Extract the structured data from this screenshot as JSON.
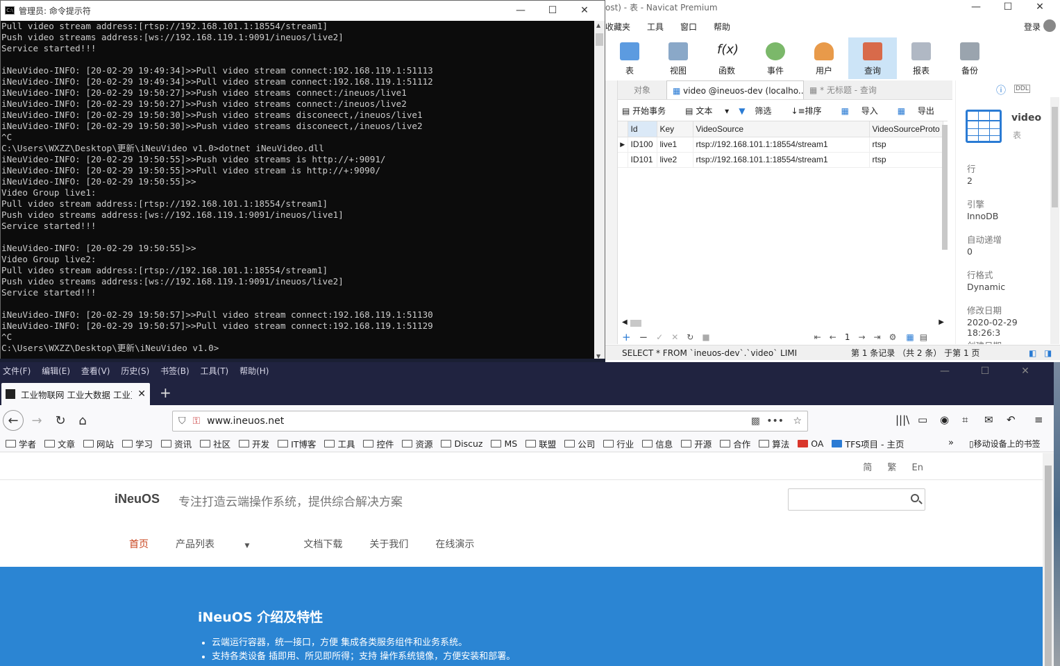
{
  "cmd": {
    "title": "管理员: 命令提示符",
    "lines": [
      "Pull video stream address:[rtsp://192.168.101.1:18554/stream1]",
      "Push video streams address:[ws://192.168.119.1:9091/ineuos/live2]",
      "Service started!!!",
      "",
      "iNeuVideo-INFO: [20-02-29 19:49:34]>>Pull video stream connect:192.168.119.1:51113",
      "iNeuVideo-INFO: [20-02-29 19:49:34]>>Pull video stream connect:192.168.119.1:51112",
      "iNeuVideo-INFO: [20-02-29 19:50:27]>>Push video streams connect:/ineuos/live1",
      "iNeuVideo-INFO: [20-02-29 19:50:27]>>Push video streams connect:/ineuos/live2",
      "iNeuVideo-INFO: [20-02-29 19:50:30]>>Push video streams disconeect,/ineuos/live1",
      "iNeuVideo-INFO: [20-02-29 19:50:30]>>Push video streams disconeect,/ineuos/live2",
      "^C",
      "C:\\Users\\WXZZ\\Desktop\\更新\\iNeuVideo v1.0>dotnet iNeuVideo.dll",
      "iNeuVideo-INFO: [20-02-29 19:50:55]>>Push video streams is http://+:9091/",
      "iNeuVideo-INFO: [20-02-29 19:50:55]>>Pull video stream is http://+:9090/",
      "iNeuVideo-INFO: [20-02-29 19:50:55]>>",
      "Video Group live1:",
      "Pull video stream address:[rtsp://192.168.101.1:18554/stream1]",
      "Push video streams address:[ws://192.168.119.1:9091/ineuos/live1]",
      "Service started!!!",
      "",
      "iNeuVideo-INFO: [20-02-29 19:50:55]>>",
      "Video Group live2:",
      "Pull video stream address:[rtsp://192.168.101.1:18554/stream1]",
      "Push video streams address:[ws://192.168.119.1:9091/ineuos/live2]",
      "Service started!!!",
      "",
      "iNeuVideo-INFO: [20-02-29 19:50:57]>>Pull video stream connect:192.168.119.1:51130",
      "iNeuVideo-INFO: [20-02-29 19:50:57]>>Pull video stream connect:192.168.119.1:51129",
      "^C",
      "C:\\Users\\WXZZ\\Desktop\\更新\\iNeuVideo v1.0>"
    ]
  },
  "navicat": {
    "title": "ost) - 表 - Navicat Premium",
    "menu": [
      "收藏夹",
      "工具",
      "窗口",
      "帮助"
    ],
    "login": "登录",
    "toolbar": [
      "表",
      "视图",
      "函数",
      "事件",
      "用户",
      "查询",
      "报表",
      "备份"
    ],
    "tabs": [
      "对象",
      "video @ineuos-dev (localho...",
      "* 无标题 - 查询"
    ],
    "subtool": [
      "开始事务",
      "文本",
      "筛选",
      "排序",
      "导入",
      "导出"
    ],
    "columns": [
      "Id",
      "Key",
      "VideoSource",
      "VideoSourceProto"
    ],
    "rows": [
      [
        "ID100",
        "live1",
        "rtsp://192.168.101.1:18554/stream1",
        "rtsp"
      ],
      [
        "ID101",
        "live2",
        "rtsp://192.168.101.1:18554/stream1",
        "rtsp"
      ]
    ],
    "page_number": "1",
    "sql": "SELECT * FROM `ineuos-dev`.`video` LIMIT",
    "record_status": "第 1 条记录 （共 2 条） 于第 1 页",
    "side": {
      "name": "video",
      "type": "表",
      "rows_label": "行",
      "rows_value": "2",
      "engine_label": "引擎",
      "engine_value": "InnoDB",
      "autoinc_label": "自动递增",
      "autoinc_value": "0",
      "format_label": "行格式",
      "format_value": "Dynamic",
      "modified_label": "修改日期",
      "modified_value": "2020-02-29 18:26:3",
      "created_label": "创建日期"
    }
  },
  "browser": {
    "menu": [
      "文件(F)",
      "编辑(E)",
      "查看(V)",
      "历史(S)",
      "书签(B)",
      "工具(T)",
      "帮助(H)"
    ],
    "tab_title": "工业物联网 工业大数据 工业互",
    "url": "www.ineuos.net",
    "bookmarks": [
      "学者",
      "文章",
      "网站",
      "学习",
      "资讯",
      "社区",
      "开发",
      "IT博客",
      "工具",
      "控件",
      "资源",
      "Discuz",
      "MS",
      "联盟",
      "公司",
      "行业",
      "信息",
      "开源",
      "合作",
      "算法",
      "OA",
      "TFS项目 - 主页"
    ],
    "mobile_bookmarks": "移动设备上的书签",
    "page": {
      "langs": [
        "简",
        "繁",
        "En"
      ],
      "brand": "iNeuOS",
      "slogan": "专注打造云端操作系统，提供综合解决方案",
      "nav": [
        "首页",
        "产品列表",
        "文档下载",
        "关于我们",
        "在线演示"
      ],
      "hero_title": "iNeuOS 介绍及特性",
      "hero_items": [
        "云端运行容器，统一接口，方便 集成各类服务组件和业务系统。",
        "支持各类设备 插即用、所见即所得；支持 操作系统镜像，方便安装和部署。"
      ]
    }
  },
  "colors": {
    "accent": "#2b85d3",
    "nav_active": "#c8441e",
    "console_bg": "#0c0c0c",
    "browser_chrome": "#202340"
  }
}
